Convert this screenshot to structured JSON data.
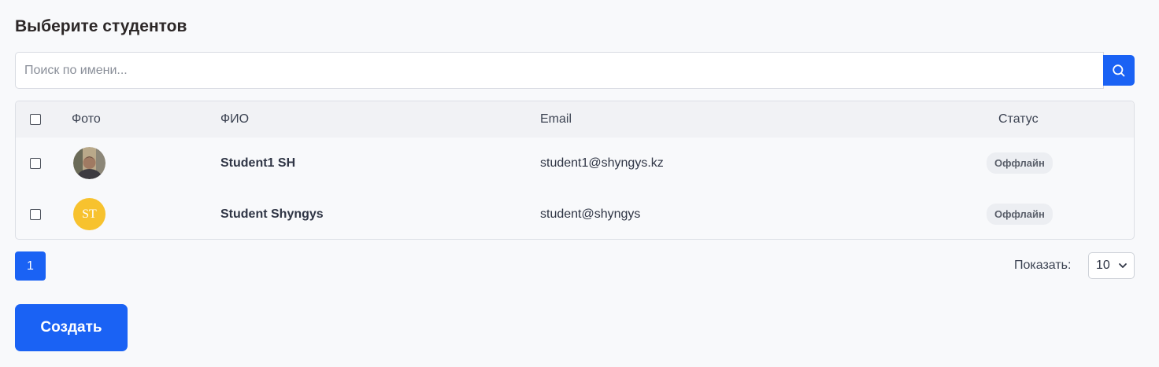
{
  "title": "Выберите студентов",
  "search": {
    "placeholder": "Поиск по имени...",
    "value": ""
  },
  "table": {
    "headers": {
      "photo": "Фото",
      "name": "ФИО",
      "email": "Email",
      "status": "Статус"
    },
    "rows": [
      {
        "avatar": "photo",
        "initials": "",
        "name": "Student1 SH",
        "email": "student1@shyngys.kz",
        "status": "Оффлайн"
      },
      {
        "avatar": "initials",
        "initials": "ST",
        "name": "Student Shyngys",
        "email": "student@shyngys",
        "status": "Оффлайн"
      }
    ]
  },
  "pagination": {
    "current_page": "1",
    "show_label": "Показать:",
    "page_size": "10"
  },
  "actions": {
    "create_label": "Создать"
  },
  "colors": {
    "accent": "#1a62f4",
    "avatar_initials_bg": "#f7c22e"
  },
  "icons": {
    "search": "search-icon",
    "select": "chevron-down-icon"
  }
}
